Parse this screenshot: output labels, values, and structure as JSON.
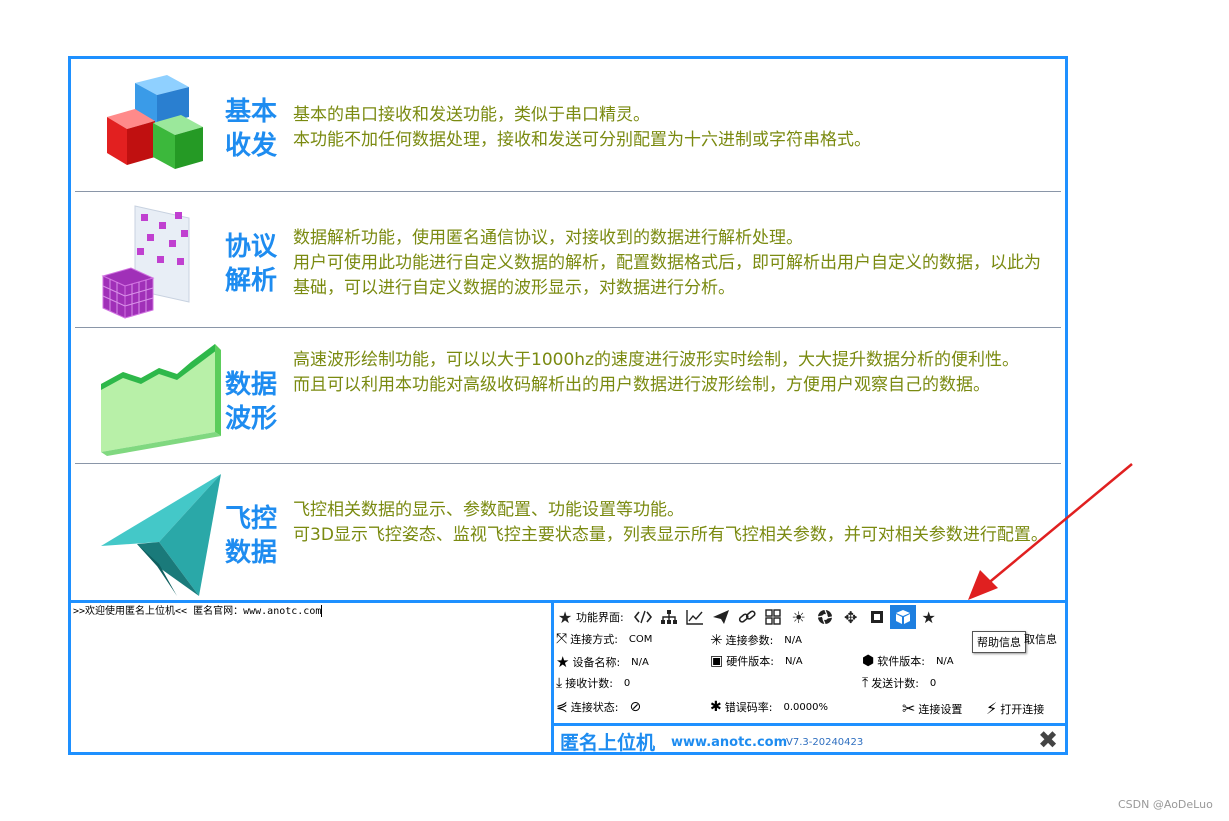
{
  "features": [
    {
      "title": "基本\n收发",
      "desc": [
        "基本的串口接收和发送功能，类似于串口精灵。",
        "本功能不加任何数据处理，接收和发送可分别配置为十六进制或字符串格式。"
      ]
    },
    {
      "title": "协议\n解析",
      "desc": [
        "数据解析功能，使用匿名通信协议，对接收到的数据进行解析处理。",
        "用户可使用此功能进行自定义数据的解析，配置数据格式后，即可解析出用户自定义的数据，以此为基础，可以进行自定义数据的波形显示，对数据进行分析。"
      ]
    },
    {
      "title": "数据\n波形",
      "desc": [
        "高速波形绘制功能，可以以大于1000hz的速度进行波形实时绘制，大大提升数据分析的便利性。",
        "而且可以利用本功能对高级收码解析出的用户数据进行波形绘制，方便用户观察自己的数据。"
      ]
    },
    {
      "title": "飞控\n数据",
      "desc": [
        "飞控相关数据的显示、参数配置、功能设置等功能。",
        "可3D显示飞控姿态、监视飞控主要状态量，列表显示所有飞控相关参数，并可对相关参数进行配置。"
      ]
    }
  ],
  "console": {
    "text": ">>欢迎使用匿名上位机<<   匿名官网：www.anotc.com"
  },
  "panel": {
    "func_label": "功能界面:",
    "tooltip": "帮助信息",
    "tooltip_tail": "取信息",
    "conn_mode_label": "连接方式:",
    "conn_mode_value": "COM",
    "conn_param_label": "连接参数:",
    "conn_param_value": "N/A",
    "device_label": "设备名称:",
    "device_value": "N/A",
    "hw_label": "硬件版本:",
    "hw_value": "N/A",
    "sw_label": "软件版本:",
    "sw_value": "N/A",
    "rx_label": "接收计数:",
    "rx_value": "0",
    "tx_label": "发送计数:",
    "tx_value": "0",
    "state_label": "连接状态:",
    "err_label": "错误码率:",
    "err_value": "0.0000%",
    "settings_label": "连接设置",
    "open_label": "打开连接"
  },
  "status": {
    "brand": "匿名上位机",
    "site": "www.anotc.com",
    "version": "V7.3-20240423"
  },
  "watermark": "CSDN @AoDeLuo",
  "colors": {
    "accent": "#1e90ff",
    "title": "#1e8cf0",
    "desc": "#7a8a10",
    "arrow": "#e02020"
  }
}
